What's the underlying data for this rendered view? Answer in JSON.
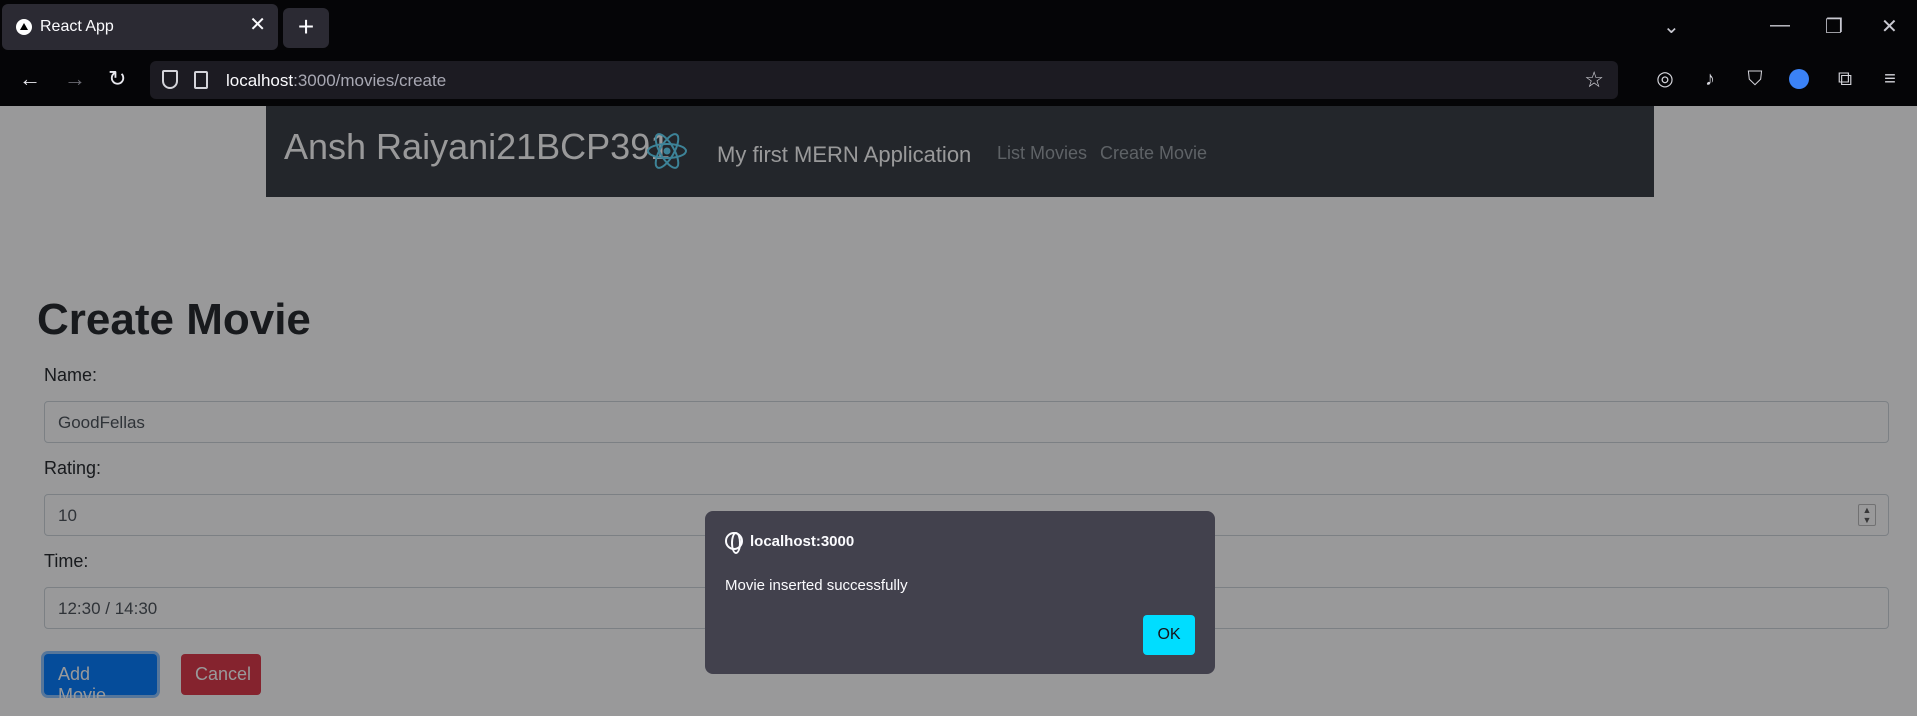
{
  "browser": {
    "tab_title": "React App",
    "new_tab_label": "+",
    "url_host": "localhost",
    "url_path": ":3000/movies/create"
  },
  "app": {
    "brand": "Ansh Raiyani21BCP391",
    "subtitle": "My first MERN Application",
    "nav": {
      "list_movies": "List Movies",
      "create_movie": "Create Movie"
    },
    "accent_color": "#61dafb"
  },
  "form": {
    "title": "Create Movie",
    "name_label": "Name:",
    "name_value": "GoodFellas",
    "rating_label": "Rating:",
    "rating_value": "10",
    "time_label": "Time:",
    "time_value": "12:30 / 14:30",
    "add_button": "Add Movie",
    "cancel_button": "Cancel"
  },
  "dialog": {
    "origin": "localhost:3000",
    "message": "Movie inserted successfully",
    "ok_label": "OK"
  },
  "colors": {
    "primary": "#007bff",
    "danger": "#dc3545",
    "dialog_button": "#00ddff"
  }
}
